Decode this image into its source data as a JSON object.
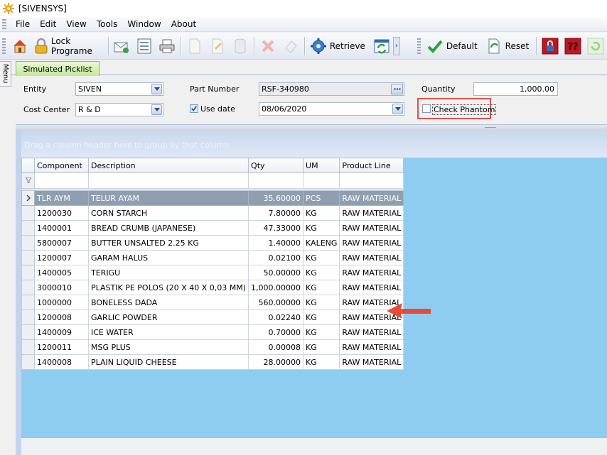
{
  "window": {
    "title": "[SIVENSYS]"
  },
  "menu": {
    "items": [
      {
        "label": "File"
      },
      {
        "label": "Edit"
      },
      {
        "label": "View"
      },
      {
        "label": "Tools"
      },
      {
        "label": "Window"
      },
      {
        "label": "About"
      }
    ]
  },
  "toolbar": {
    "lock_label": "Lock Programe",
    "retrieve_label": "Retrieve",
    "default_label": "Default",
    "reset_label": "Reset"
  },
  "side_tab": {
    "label": "Menu"
  },
  "tabs": [
    {
      "label": "Simulated Picklist"
    }
  ],
  "form": {
    "entity_label": "Entity",
    "entity_value": "SIVEN",
    "cost_center_label": "Cost Center",
    "cost_center_value": "R & D",
    "part_number_label": "Part Number",
    "part_number_value": "RSF-340980",
    "use_date_label": "Use date",
    "use_date_checked": true,
    "date_value": "08/06/2020",
    "quantity_label": "Quantity",
    "quantity_value": "1,000.00",
    "check_phantom_label": "Check Phantom",
    "check_phantom_checked": false
  },
  "grid": {
    "group_hint": "Drag a column header here to group by that column",
    "columns": [
      "Component",
      "Description",
      "Qty",
      "UM",
      "Product Line"
    ],
    "rows": [
      {
        "component": "TLR AYM",
        "description": "TELUR AYAM",
        "qty": "35.60000",
        "um": "PCS",
        "product_line": "RAW MATERIAL"
      },
      {
        "component": "1200030",
        "description": "CORN STARCH",
        "qty": "7.80000",
        "um": "KG",
        "product_line": "RAW MATERIAL"
      },
      {
        "component": "1400001",
        "description": "BREAD CRUMB (JAPANESE)",
        "qty": "47.33000",
        "um": "KG",
        "product_line": "RAW MATERIAL"
      },
      {
        "component": "5800007",
        "description": "BUTTER UNSALTED 2.25 KG",
        "qty": "1.40000",
        "um": "KALENG",
        "product_line": "RAW MATERIAL"
      },
      {
        "component": "1200007",
        "description": "GARAM HALUS",
        "qty": "0.02100",
        "um": "KG",
        "product_line": "RAW MATERIAL"
      },
      {
        "component": "1400005",
        "description": "TERIGU",
        "qty": "50.00000",
        "um": "KG",
        "product_line": "RAW MATERIAL"
      },
      {
        "component": "3000010",
        "description": "PLASTIK PE POLOS (20 X 40 X 0,03 MM)",
        "qty": "1,000.00000",
        "um": "KG",
        "product_line": "RAW MATERIAL"
      },
      {
        "component": "1000000",
        "description": "BONELESS DADA",
        "qty": "560.00000",
        "um": "KG",
        "product_line": "RAW MATERIAL"
      },
      {
        "component": "1200008",
        "description": "GARLIC POWDER",
        "qty": "0.02240",
        "um": "KG",
        "product_line": "RAW MATERIAL"
      },
      {
        "component": "1400009",
        "description": "ICE WATER",
        "qty": "0.70000",
        "um": "KG",
        "product_line": "RAW MATERIAL"
      },
      {
        "component": "1200011",
        "description": "MSG PLUS",
        "qty": "0.00008",
        "um": "KG",
        "product_line": "RAW MATERIAL"
      },
      {
        "component": "1400008",
        "description": "PLAIN LIQUID CHEESE",
        "qty": "28.00000",
        "um": "KG",
        "product_line": "RAW MATERIAL"
      }
    ],
    "selected_row": 0
  },
  "colors": {
    "grid_empty": "#8ecdef",
    "selected_row": "#8f9fb0",
    "annotation_red": "#d9534f"
  }
}
